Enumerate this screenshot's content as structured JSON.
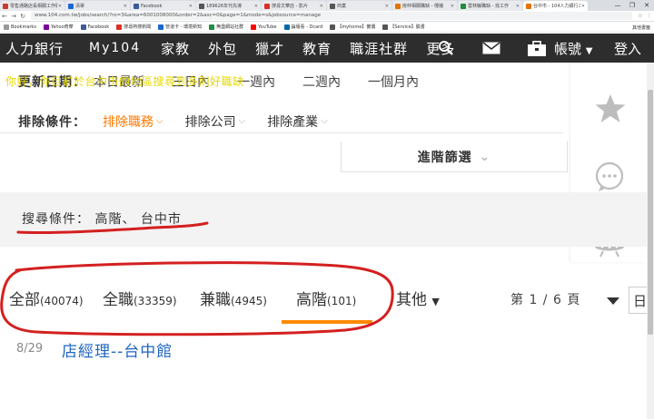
{
  "browser": {
    "tabs": [
      {
        "label": "零售通路店長相關工作職缺",
        "color": "#cc3b2f"
      },
      {
        "label": "清單",
        "color": "#1967d2"
      },
      {
        "label": "Facebook",
        "color": "#3b5998"
      },
      {
        "label": "189626年代先導",
        "color": "#555555"
      },
      {
        "label": "搜尋文華店 - 影片",
        "color": "#d93025"
      },
      {
        "label": "商業",
        "color": "#555555"
      },
      {
        "label": "房仲相關職缺 - 傳播",
        "color": "#e37400"
      },
      {
        "label": "雲林縣職缺 - 找工作",
        "color": "#1e8e3e"
      },
      {
        "label": "台中市 - 104人力銀行工作",
        "color": "#e37400"
      }
    ],
    "window_controls": [
      "—",
      "❐",
      "✕"
    ],
    "address": "www.104.com.tw/jobs/search/?ro=3&area=6001008000&order=2&asc=0&page=1&mode=s&jobsource=manage",
    "bookmarks_label": "Bookmarks",
    "bookmarks": [
      {
        "label": "Yahoo奇摩",
        "color": "#7b0099"
      },
      {
        "label": "Facebook",
        "color": "#3b5998"
      },
      {
        "label": "搜尋熱搜新聞",
        "color": "#d93025"
      },
      {
        "label": "管道卡 - 環境新知",
        "color": "#1967d2"
      },
      {
        "label": "無盡網站社群",
        "color": "#1e8e3e"
      },
      {
        "label": "YouTube",
        "color": "#ff0000"
      },
      {
        "label": "論壇看 - Dcard",
        "color": "#006aa6"
      },
      {
        "label": "【myhome】實價",
        "color": "#555555"
      },
      {
        "label": "【Service】臉書",
        "color": "#555555"
      }
    ],
    "bookmarks_other": "其他書籤"
  },
  "site_nav": {
    "logo": "人力銀行",
    "my104": "My104",
    "items": [
      "家教",
      "外包",
      "獵才",
      "教育",
      "職涯社群",
      "更多"
    ],
    "account": "帳號",
    "login": "登入"
  },
  "overlay": {
    "text": "你好，你目前於台中市的地區搜尋到多則好職缺"
  },
  "update_row": {
    "label": "更新日期：",
    "options": [
      "本日最新",
      "三日內",
      "一週內",
      "二週內",
      "一個月內"
    ]
  },
  "exclude_row": {
    "label": "排除條件：",
    "options": [
      "排除職務",
      "排除公司",
      "排除產業"
    ]
  },
  "advanced": {
    "label": "進階篩選",
    "chevron": "⌄"
  },
  "conditions": {
    "label": "搜尋條件：",
    "values": "高階、 台中市"
  },
  "tabs": [
    {
      "label": "全部",
      "count": "(40074)"
    },
    {
      "label": "全職",
      "count": "(33359)"
    },
    {
      "label": "兼職",
      "count": "(4945)"
    },
    {
      "label": "高階",
      "count": "(101)"
    }
  ],
  "more_tab": "其他",
  "pagination": {
    "text": "第 1 / 6 頁",
    "select_value": "日期"
  },
  "jobs": [
    {
      "date": "8/29",
      "title": "店經理--台中館"
    }
  ],
  "colors": {
    "accent": "#ff7800",
    "underline": "#ff8a00",
    "link": "#1f66c1",
    "annotation": "#d42020",
    "nav_bg": "#2d2d2d"
  }
}
